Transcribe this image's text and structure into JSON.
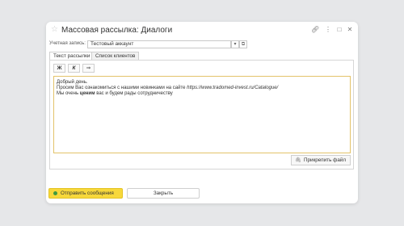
{
  "window": {
    "title": "Массовая рассылка: Диалоги"
  },
  "account": {
    "label": "Учетная запись:",
    "value": "Тестовый аккаунт"
  },
  "tabs": [
    {
      "label": "Текст рассылки",
      "active": true
    },
    {
      "label": "Список клиентов",
      "active": false
    }
  ],
  "format": {
    "bold": "Ж",
    "italic": "К",
    "link": "⇒"
  },
  "message": {
    "line1": "Добрый день.",
    "line2_text": "Просим Вас ознакомиться с нашими новинками на сайте ",
    "line2_link": "https://www.tradomed-invest.ru/Catalogue/",
    "line3_before": "Мы очень ",
    "line3_bold": "ценим",
    "line3_after": " вас и будем рады сотрудничеству"
  },
  "buttons": {
    "attach": "Прикрепить файл",
    "send": "Отправить сообщения",
    "close": "Закрыть"
  },
  "colors": {
    "accent": "#f7d83b",
    "editor_border": "#e3c36a",
    "send_indicator": "#3f9a3f"
  }
}
